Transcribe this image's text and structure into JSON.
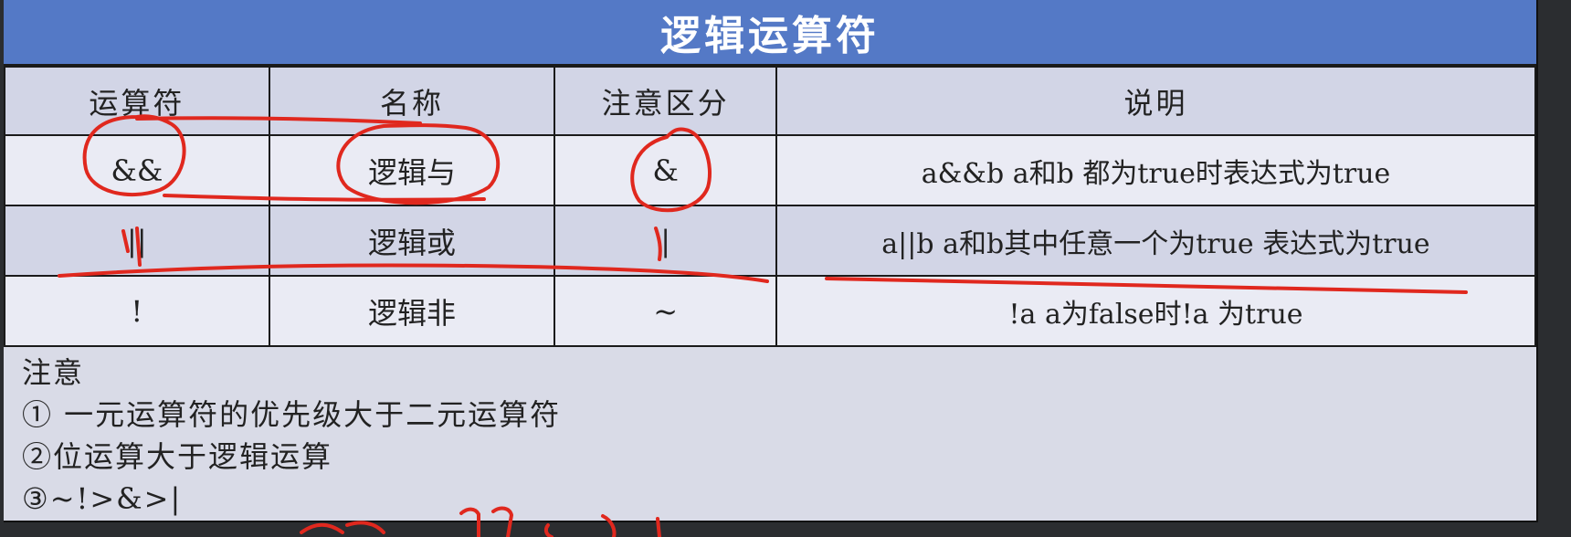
{
  "title": "逻辑运算符",
  "table": {
    "headers": [
      "运算符",
      "名称",
      "注意区分",
      "说明"
    ],
    "rows": [
      {
        "operator": "&&",
        "name": "逻辑与",
        "distinguish": "&",
        "description": "a&&b a和b 都为true时表达式为true"
      },
      {
        "operator": "||",
        "name": "逻辑或",
        "distinguish": "|",
        "description": "a||b a和b其中任意一个为true 表达式为true"
      },
      {
        "operator": "!",
        "name": "逻辑非",
        "distinguish": "~",
        "description": "!a  a为false时!a 为true"
      }
    ]
  },
  "notes": {
    "heading": "注意",
    "items": [
      "① 一元运算符的优先级大于二元运算符",
      "②位运算大于逻辑运算",
      "③~!>&>|"
    ]
  },
  "colors": {
    "title_bar": "#5479c6",
    "title_text": "#ffffff",
    "row_dark": "#d2d5e6",
    "row_light": "#eaebf4",
    "annotation_ink": "#e0281e",
    "background": "#2b2d30"
  }
}
